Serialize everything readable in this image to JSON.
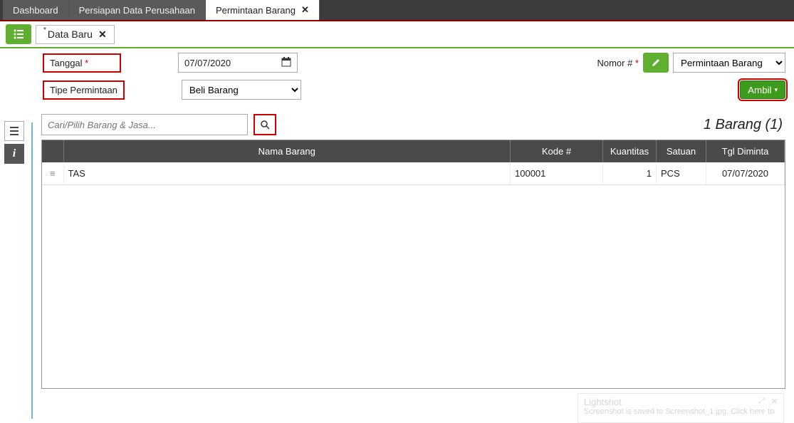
{
  "topTabs": [
    "Dashboard",
    "Persiapan Data Perusahaan",
    "Permintaan Barang"
  ],
  "activeTopTab": 2,
  "innerTab": {
    "label": "Data Baru",
    "dirty": "*"
  },
  "form": {
    "tanggal": {
      "label": "Tanggal",
      "value": "07/07/2020"
    },
    "tipe": {
      "label": "Tipe Permintaan",
      "value": "Beli Barang"
    },
    "nomor": {
      "label": "Nomor #",
      "value": "Permintaan Barang"
    },
    "ambil": "Ambil"
  },
  "search": {
    "placeholder": "Cari/Pilih Barang & Jasa..."
  },
  "countLabel": "1 Barang (1)",
  "columns": {
    "nama": "Nama Barang",
    "kode": "Kode #",
    "kuantitas": "Kuantitas",
    "satuan": "Satuan",
    "tgl": "Tgl Diminta"
  },
  "rows": [
    {
      "nama": "TAS",
      "kode": "100001",
      "kuantitas": "1",
      "satuan": "PCS",
      "tgl": "07/07/2020"
    }
  ],
  "lightshot": {
    "title": "Lightshot",
    "msg": "Screenshot is saved to Screenshot_1.jpg. Click here to"
  }
}
